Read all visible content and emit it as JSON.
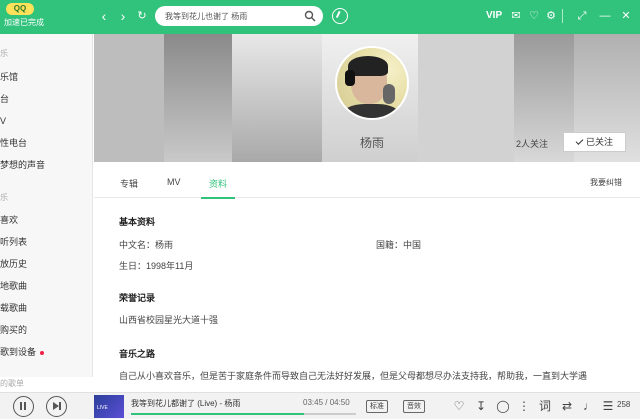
{
  "app": {
    "logo_text": "QQ",
    "logo_sub": "加速已完成"
  },
  "search": {
    "value": "我等到花儿也谢了 杨雨",
    "placeholder": ""
  },
  "topbar": {
    "vip": "VIP"
  },
  "sidebar": {
    "head1": "乐",
    "items": [
      {
        "label": "乐馆"
      },
      {
        "label": "台"
      },
      {
        "label": "V"
      },
      {
        "label": "性电台"
      },
      {
        "label": "梦想的声音"
      }
    ],
    "head2": "乐",
    "items2": [
      {
        "label": "喜欢"
      },
      {
        "label": "听列表"
      },
      {
        "label": "放历史"
      },
      {
        "label": "地歌曲"
      },
      {
        "label": "载歌曲"
      },
      {
        "label": "购买的"
      },
      {
        "label": "歌到设备"
      }
    ],
    "footer": "的歌单"
  },
  "artist": {
    "name": "杨雨",
    "fans": "2人关注",
    "follow_label": "已关注"
  },
  "tabs": {
    "items": [
      "专辑",
      "MV",
      "资料"
    ],
    "active": "资料",
    "report": "我要纠错"
  },
  "profile": {
    "basic_title": "基本资料",
    "chinese_name": "中文名：杨雨",
    "nationality": "国籍：中国",
    "birthday": "生日：1998年11月",
    "honor_title": "荣誉记录",
    "honor_text": "山西省校园星光大道十强",
    "road_title": "音乐之路",
    "road_text": "自己从小喜欢音乐，但是苦于家庭条件而导致自己无法好好发展，但是父母都想尽办法支持我，帮助我，一直到大学遇"
  },
  "player": {
    "song": "我等到花儿都谢了 (Live) - 杨雨",
    "time": "03:45 / 04:50",
    "progress": 0.77,
    "quality": "标准",
    "mode": "音效",
    "lyric": "词",
    "volume": "258"
  },
  "colors": {
    "accent": "#31c27c"
  }
}
